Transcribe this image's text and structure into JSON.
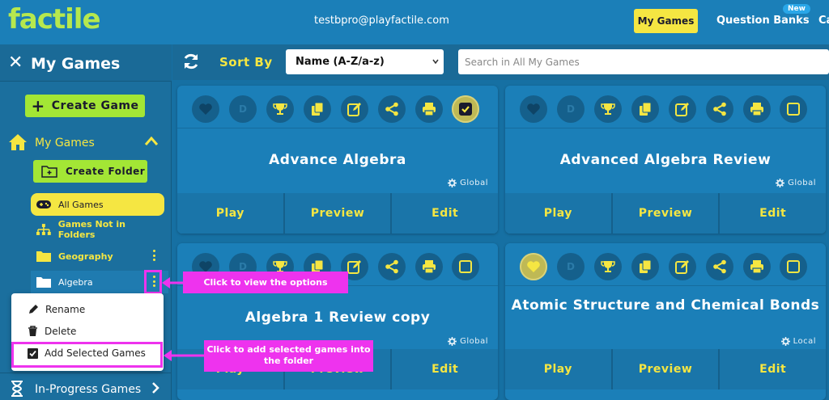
{
  "header": {
    "logo": "factile",
    "email": "testbpro@playfactile.com",
    "nav_my_games": "My Games",
    "nav_question_banks": "Question Banks",
    "nav_new_badge": "New",
    "nav_more": "Ca"
  },
  "sidebar": {
    "title": "My Games",
    "create_game": "Create Game",
    "my_games_label": "My Games",
    "create_folder": "Create Folder",
    "folders": [
      {
        "label": "All Games"
      },
      {
        "label": "Games Not in Folders"
      },
      {
        "label": "Geography"
      },
      {
        "label": "Algebra"
      }
    ],
    "in_progress": "In-Progress Games"
  },
  "context_menu": {
    "rename": "Rename",
    "delete": "Delete",
    "add_selected": "Add Selected Games"
  },
  "toolbar": {
    "sort_by": "Sort By",
    "sort_value": "Name (A-Z/a-z)",
    "search_placeholder": "Search in All My Games"
  },
  "cards": [
    {
      "title": "Advance Algebra",
      "scope": "Global",
      "play": "Play",
      "preview": "Preview",
      "edit": "Edit",
      "favorited": false,
      "selected": true
    },
    {
      "title": "Advanced Algebra Review",
      "scope": "Global",
      "play": "Play",
      "preview": "Preview",
      "edit": "Edit",
      "favorited": false,
      "selected": false
    },
    {
      "title": "Algebra 1 Review copy",
      "scope": "Global",
      "play": "Play",
      "preview": "Preview",
      "edit": "Edit",
      "favorited": false,
      "selected": false
    },
    {
      "title": "Atomic Structure and Chemical Bonds",
      "scope": "Local",
      "play": "Play",
      "preview": "Preview",
      "edit": "Edit",
      "favorited": true,
      "selected": false
    }
  ],
  "card_icons": [
    "heart-icon",
    "d-badge-icon",
    "trophy-icon",
    "copy-icon",
    "edit-icon",
    "share-icon",
    "print-icon",
    "checkbox-icon"
  ],
  "card_d_label": "D",
  "annotations": {
    "options": "Click to view the options",
    "add_selected": "Click to add selected games into the folder"
  },
  "colors": {
    "brand_green": "#b6e84e",
    "accent_yellow": "#f5e642",
    "annotation_magenta": "#ee33ee",
    "primary_blue": "#1b7fb8"
  }
}
